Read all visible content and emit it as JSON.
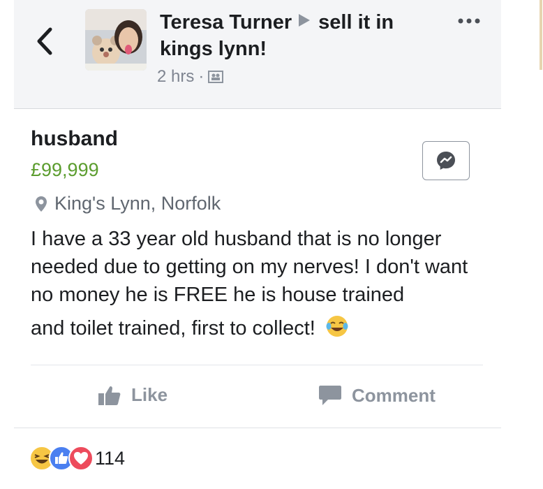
{
  "header": {
    "poster_name": "Teresa Turner",
    "group_name": "sell it in kings lynn!",
    "timestamp": "2 hrs",
    "separator": "·"
  },
  "listing": {
    "title": "husband",
    "price": "£99,999",
    "location": "King's Lynn, Norfolk",
    "description_main": "I have a 33 year old husband that is no longer needed due to getting on my nerves! I don't want no money he is FREE he is house trained",
    "description_last": "and toilet trained, first to collect!"
  },
  "actions": {
    "like_label": "Like",
    "comment_label": "Comment"
  },
  "reactions": {
    "count": "114",
    "types": [
      "haha",
      "like",
      "love"
    ]
  },
  "colors": {
    "price": "#5c9d2f",
    "header_bg": "#f4f5f7",
    "like_blue": "#4a7ff0",
    "love_red": "#ed4b5c",
    "haha_yellow": "#f6c644"
  },
  "icons": {
    "back": "chevron-left-icon",
    "more": "more-dots-icon",
    "audience": "group-audience-icon",
    "location": "location-pin-icon",
    "messenger": "messenger-icon",
    "like": "thumbs-up-icon",
    "comment": "comment-bubble-icon",
    "emoji": "tears-of-joy-emoji"
  }
}
